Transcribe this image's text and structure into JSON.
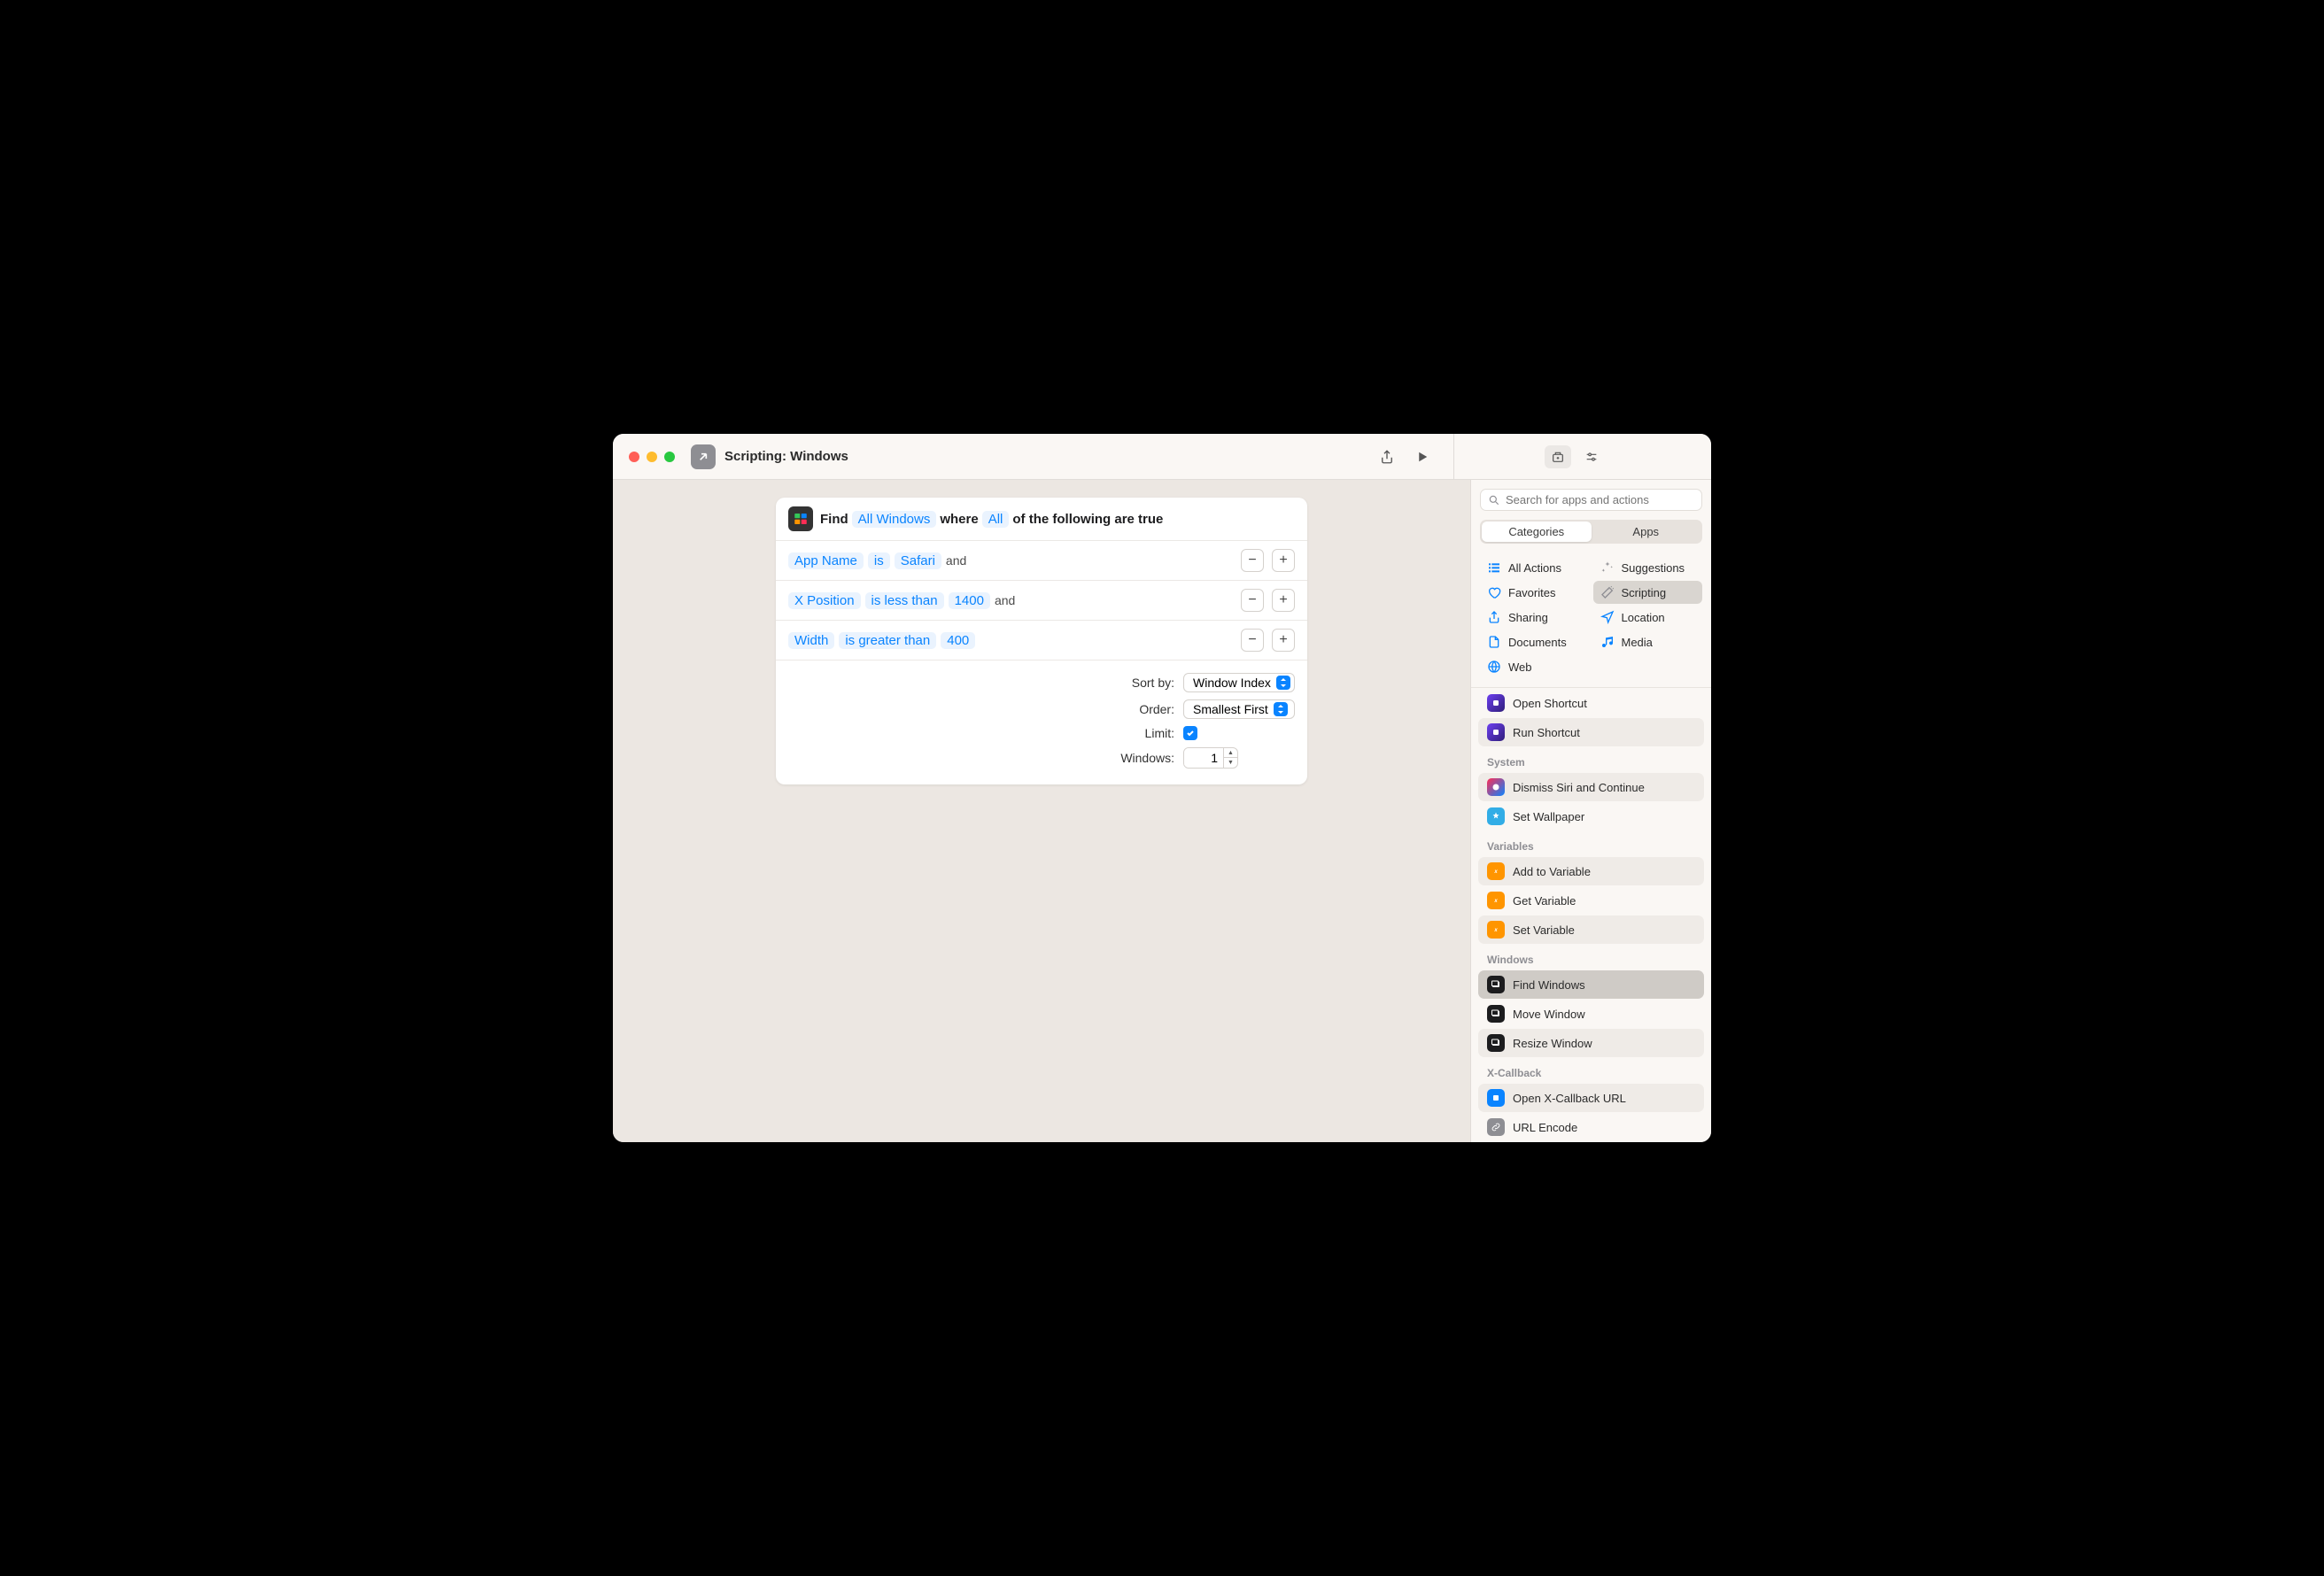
{
  "window": {
    "title": "Scripting: Windows"
  },
  "action": {
    "header": {
      "word_find": "Find",
      "token_windows": "All Windows",
      "word_where": "where",
      "token_all": "All",
      "suffix": "of the following are true"
    },
    "filters": [
      {
        "field": "App Name",
        "operator": "is",
        "value": "Safari",
        "connector": "and"
      },
      {
        "field": "X Position",
        "operator": "is less than",
        "value": "1400",
        "connector": "and"
      },
      {
        "field": "Width",
        "operator": "is greater than",
        "value": "400",
        "connector": ""
      }
    ],
    "options": {
      "sort_by_label": "Sort by:",
      "sort_by_value": "Window Index",
      "order_label": "Order:",
      "order_value": "Smallest First",
      "limit_label": "Limit:",
      "limit_checked": true,
      "windows_label": "Windows:",
      "windows_value": "1"
    }
  },
  "sidebar": {
    "search_placeholder": "Search for apps and actions",
    "tabs": {
      "categories": "Categories",
      "apps": "Apps"
    },
    "categories": [
      {
        "label": "All Actions",
        "icon": "list",
        "color": "blue"
      },
      {
        "label": "Suggestions",
        "icon": "wand",
        "color": "gray"
      },
      {
        "label": "Favorites",
        "icon": "heart",
        "color": "blue"
      },
      {
        "label": "Scripting",
        "icon": "wand2",
        "color": "gray",
        "selected": true
      },
      {
        "label": "Sharing",
        "icon": "share",
        "color": "blue"
      },
      {
        "label": "Location",
        "icon": "nav",
        "color": "blue"
      },
      {
        "label": "Documents",
        "icon": "doc",
        "color": "blue"
      },
      {
        "label": "Media",
        "icon": "music",
        "color": "blue"
      },
      {
        "label": "Web",
        "icon": "globe",
        "color": "blue"
      }
    ],
    "groups": [
      {
        "header": "",
        "items": [
          {
            "label": "Open Shortcut",
            "icon": "purple",
            "alt": false
          },
          {
            "label": "Run Shortcut",
            "icon": "purple",
            "alt": true
          }
        ]
      },
      {
        "header": "System",
        "items": [
          {
            "label": "Dismiss Siri and Continue",
            "icon": "siri",
            "alt": true
          },
          {
            "label": "Set Wallpaper",
            "icon": "blue",
            "alt": false
          }
        ]
      },
      {
        "header": "Variables",
        "items": [
          {
            "label": "Add to Variable",
            "icon": "orange",
            "alt": true
          },
          {
            "label": "Get Variable",
            "icon": "orange",
            "alt": false
          },
          {
            "label": "Set Variable",
            "icon": "orange",
            "alt": true
          }
        ]
      },
      {
        "header": "Windows",
        "items": [
          {
            "label": "Find Windows",
            "icon": "dark",
            "selected": true
          },
          {
            "label": "Move Window",
            "icon": "dark",
            "alt": false
          },
          {
            "label": "Resize Window",
            "icon": "dark",
            "alt": true
          }
        ]
      },
      {
        "header": "X-Callback",
        "items": [
          {
            "label": "Open X-Callback URL",
            "icon": "blue2",
            "alt": true
          },
          {
            "label": "URL Encode",
            "icon": "gray",
            "alt": false
          }
        ]
      }
    ]
  }
}
